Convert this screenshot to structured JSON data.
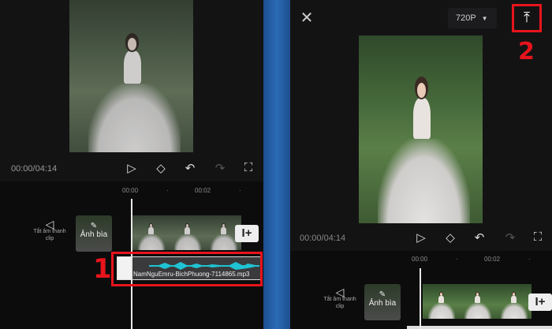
{
  "left": {
    "time": "00:00/04:14",
    "ticks": [
      "00:00",
      "00:02"
    ],
    "mute_label": "Tắt âm thanh clip",
    "cover_label": "Ảnh bìa",
    "audio_clip": "NamNguEmru-BichPhuong-7114865.mp3",
    "step": "1"
  },
  "right": {
    "resolution": "720P",
    "step": "2",
    "time": "00:00/04:14",
    "ticks": [
      "00:00",
      "00:02"
    ],
    "mute_label": "Tắt âm thanh clip",
    "cover_label": "Ảnh bìa"
  },
  "colors": {
    "highlight": "#e8141c",
    "waveform": "#1fc3d3",
    "divider": "#2a6ab5"
  }
}
